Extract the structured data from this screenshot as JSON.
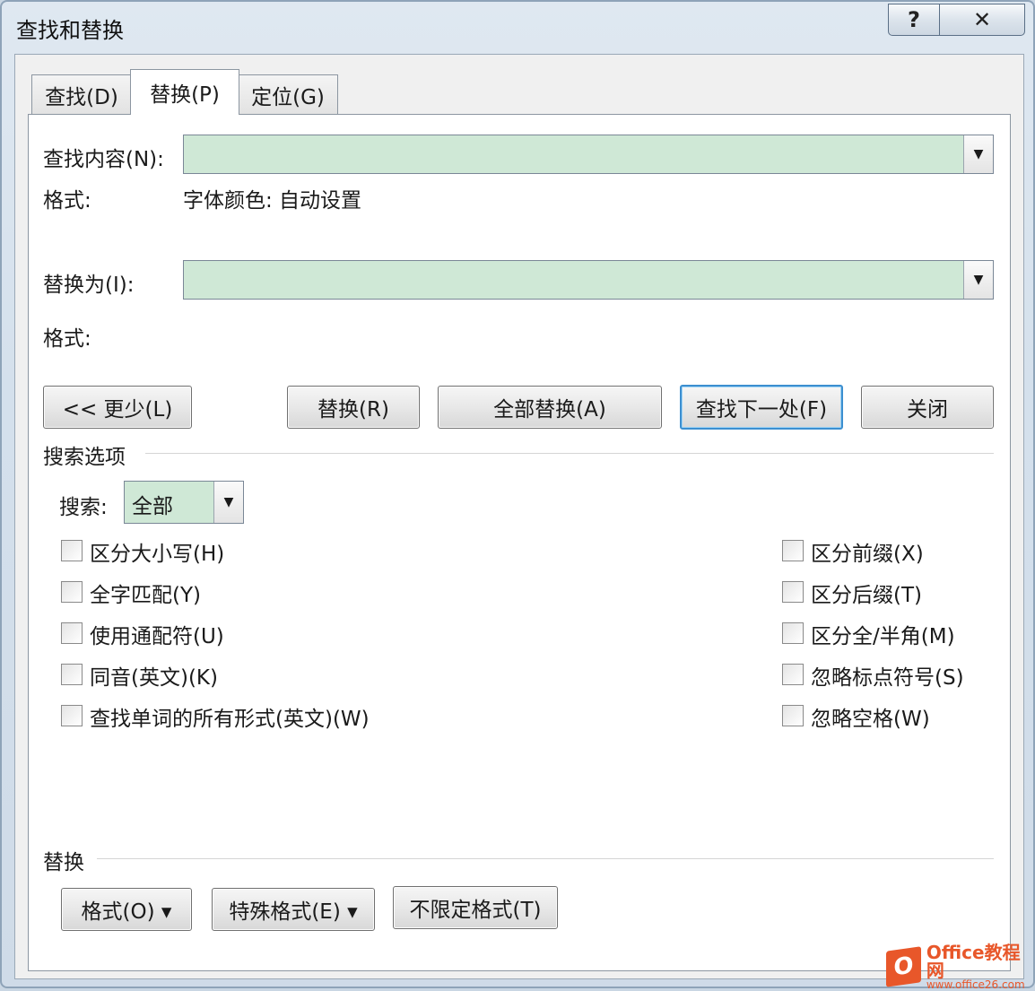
{
  "window": {
    "title": "查找和替换",
    "help_label": "?",
    "close_label": "✕"
  },
  "tabs": [
    {
      "label": "查找(D)",
      "active": false
    },
    {
      "label": "替换(P)",
      "active": true
    },
    {
      "label": "定位(G)",
      "active": false
    }
  ],
  "find": {
    "label": "查找内容(N):",
    "value": "",
    "format_label": "格式:",
    "format_value": "字体颜色: 自动设置"
  },
  "replace": {
    "label": "替换为(I):",
    "value": "",
    "format_label": "格式:"
  },
  "buttons": {
    "less": "<< 更少(L)",
    "replace": "替换(R)",
    "replace_all": "全部替换(A)",
    "find_next": "查找下一处(F)",
    "close": "关闭"
  },
  "search_options": {
    "heading": "搜索选项",
    "search_label": "搜索:",
    "search_value": "全部",
    "left": [
      {
        "label": "区分大小写(H)",
        "checked": false
      },
      {
        "label": "全字匹配(Y)",
        "checked": false
      },
      {
        "label": "使用通配符(U)",
        "checked": false
      },
      {
        "label": "同音(英文)(K)",
        "checked": false
      },
      {
        "label": "查找单词的所有形式(英文)(W)",
        "checked": false
      }
    ],
    "right": [
      {
        "label": "区分前缀(X)",
        "checked": false
      },
      {
        "label": "区分后缀(T)",
        "checked": false
      },
      {
        "label": "区分全/半角(M)",
        "checked": false
      },
      {
        "label": "忽略标点符号(S)",
        "checked": false
      },
      {
        "label": "忽略空格(W)",
        "checked": false
      }
    ]
  },
  "replace_section": {
    "heading": "替换",
    "format_button": "格式(O) ▾",
    "special_button": "特殊格式(E) ▾",
    "no_format_button": "不限定格式(T)"
  },
  "watermark": {
    "logo": "O",
    "main": "Office教程网",
    "url": "www.office26.com"
  },
  "colors": {
    "field_fill": "#cfe8d6",
    "default_button_border": "#3c8fd0"
  }
}
